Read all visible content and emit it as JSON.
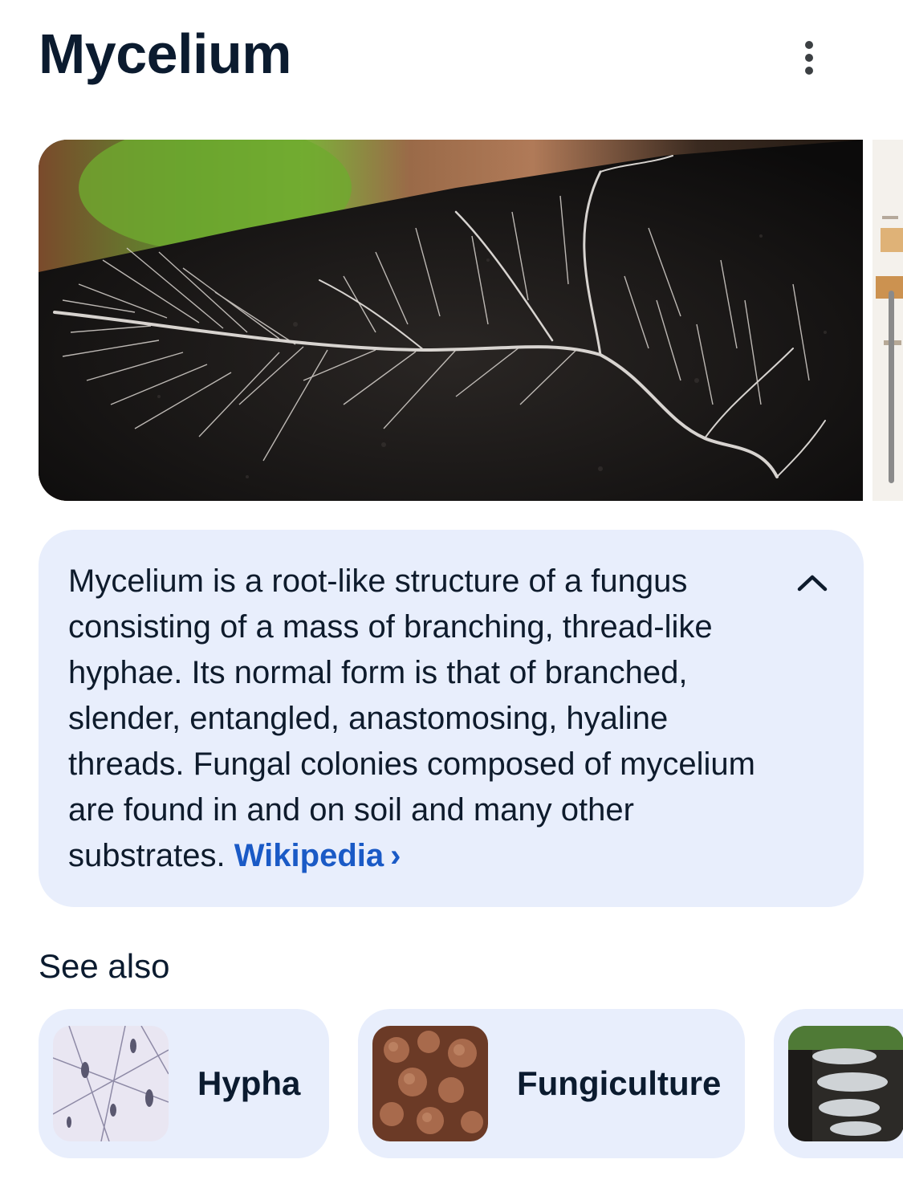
{
  "header": {
    "title": "Mycelium",
    "more_icon": "more-vert-icon"
  },
  "summary": {
    "text": "Mycelium is a root-like structure of a fungus consisting of a mass of branching, thread-like hyphae. Its normal form is that of branched, slender, entangled, anastomosing, hyaline threads. Fungal colonies composed of mycelium are found in and on soil and many other substrates.",
    "source_label": "Wikipedia",
    "source_chevron": "›",
    "collapse_icon": "chevron-up-icon"
  },
  "see_also": {
    "heading": "See also",
    "items": [
      {
        "label": "Hypha"
      },
      {
        "label": "Fungiculture"
      },
      {
        "label": ""
      }
    ]
  },
  "colors": {
    "card_background": "#e8eefc",
    "link": "#1a5ac6",
    "title": "#0b1b2f"
  }
}
